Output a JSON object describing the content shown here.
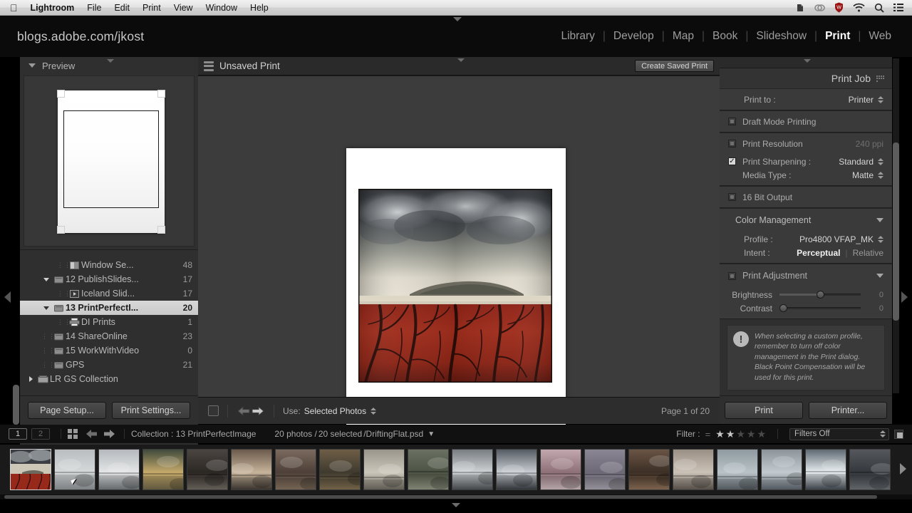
{
  "macbar": {
    "apple": "apple-logo",
    "items": [
      "Lightroom",
      "File",
      "Edit",
      "Print",
      "View",
      "Window",
      "Help"
    ],
    "status_icons": [
      "evernote-icon",
      "creative-cloud-icon",
      "shield-icon",
      "wifi-icon",
      "search-icon",
      "notification-list-icon"
    ]
  },
  "identity": {
    "plate": "blogs.adobe.com/jkost"
  },
  "modules": [
    {
      "label": "Library",
      "active": false
    },
    {
      "label": "Develop",
      "active": false
    },
    {
      "label": "Map",
      "active": false
    },
    {
      "label": "Book",
      "active": false
    },
    {
      "label": "Slideshow",
      "active": false
    },
    {
      "label": "Print",
      "active": true
    },
    {
      "label": "Web",
      "active": false
    }
  ],
  "left": {
    "preview_header": "Preview",
    "tree": [
      {
        "label": "Window Se...",
        "count": "48",
        "icon": "split-window-icon",
        "indent": 2,
        "disc": "none",
        "selected": false
      },
      {
        "label": "12 PublishSlides...",
        "count": "17",
        "icon": "folder-icon",
        "indent": 1,
        "disc": "down",
        "selected": false
      },
      {
        "label": "Iceland Slid...",
        "count": "17",
        "icon": "slideshow-icon",
        "indent": 2,
        "disc": "none",
        "selected": false
      },
      {
        "label": "13 PrintPerfectI...",
        "count": "20",
        "icon": "folder-icon",
        "indent": 1,
        "disc": "down",
        "selected": true
      },
      {
        "label": "DI Prints",
        "count": "1",
        "icon": "printer-icon",
        "indent": 2,
        "disc": "none",
        "selected": false
      },
      {
        "label": "14 ShareOnline",
        "count": "23",
        "icon": "folder-icon",
        "indent": 1,
        "disc": "none",
        "selected": false
      },
      {
        "label": "15 WorkWithVideo",
        "count": "0",
        "icon": "folder-icon",
        "indent": 1,
        "disc": "none",
        "selected": false
      },
      {
        "label": "GPS",
        "count": "21",
        "icon": "folder-icon",
        "indent": 1,
        "disc": "none",
        "selected": false
      },
      {
        "label": "LR GS Collection",
        "count": "",
        "icon": "collection-set-icon",
        "indent": 0,
        "disc": "right",
        "selected": false
      }
    ],
    "page_setup_label": "Page Setup...",
    "print_settings_label": "Print Settings..."
  },
  "center": {
    "title": "Unsaved Print",
    "create_saved_print": "Create Saved Print",
    "toolbar": {
      "use_label": "Use:",
      "use_value": "Selected Photos",
      "page_indicator": "Page 1 of 20"
    }
  },
  "right": {
    "panel_title": "Print Job",
    "print_to": {
      "label": "Print to :",
      "value": "Printer",
      "checked": null
    },
    "draft_mode": {
      "label": "Draft Mode Printing",
      "checked": false
    },
    "print_resolution": {
      "label": "Print Resolution",
      "value": "240 ppi",
      "checked": false
    },
    "print_sharpening": {
      "label": "Print Sharpening :",
      "value": "Standard",
      "checked": true
    },
    "media_type": {
      "label": "Media Type :",
      "value": "Matte"
    },
    "bit_output": {
      "label": "16 Bit Output",
      "checked": false
    },
    "color_management": {
      "header": "Color Management",
      "profile_label": "Profile :",
      "profile_value": "Pro4800 VFAP_MK",
      "intent_label": "Intent :",
      "intent_active": "Perceptual",
      "intent_other": "Relative"
    },
    "print_adjustment": {
      "header": "Print Adjustment",
      "checked": false,
      "brightness": {
        "label": "Brightness",
        "value": "0",
        "position": 50
      },
      "contrast": {
        "label": "Contrast",
        "value": "0",
        "position": 3
      }
    },
    "note": "When selecting a custom profile, remember to turn off color management in the Print dialog. Black Point Compensation will be used for this print.",
    "print_button": "Print",
    "printer_button": "Printer..."
  },
  "filmstrip": {
    "screen_buttons": [
      "1",
      "2"
    ],
    "collection_label": "Collection : 13 PrintPerfectImage",
    "photos_count": "20 photos /",
    "selected_count": "20 selected",
    "filename": "/DriftingFlat.psd",
    "filter_label": "Filter :",
    "stars_filled": 2,
    "stars_total": 5,
    "filters_value": "Filters Off",
    "thumbnails": [
      {
        "name": "drifting-flat",
        "selected": true
      },
      {
        "name": "boat-shore",
        "selected": false
      },
      {
        "name": "white-form",
        "selected": false
      },
      {
        "name": "field-road",
        "selected": false
      },
      {
        "name": "figure-dark",
        "selected": false
      },
      {
        "name": "forest-light",
        "selected": false
      },
      {
        "name": "figure-rust",
        "selected": false
      },
      {
        "name": "face-columns",
        "selected": false
      },
      {
        "name": "wire-horizon",
        "selected": false
      },
      {
        "name": "trees-lake",
        "selected": false
      },
      {
        "name": "clouds-sea",
        "selected": false
      },
      {
        "name": "skull-wings",
        "selected": false
      },
      {
        "name": "blossom-water",
        "selected": false
      },
      {
        "name": "tree-rocks",
        "selected": false
      },
      {
        "name": "rust-shape",
        "selected": false
      },
      {
        "name": "poles-field",
        "selected": false
      },
      {
        "name": "stone-band",
        "selected": false
      },
      {
        "name": "birds-water",
        "selected": false
      },
      {
        "name": "window-row",
        "selected": false
      },
      {
        "name": "dark-curve",
        "selected": false
      }
    ]
  },
  "colors": {
    "panel_bg": "#2f2f2f",
    "canvas_bg": "#3c3c3c",
    "accent_selected": "#d8d8d8",
    "text_primary": "#d2d2d2",
    "text_dim": "#7d7d7d"
  }
}
